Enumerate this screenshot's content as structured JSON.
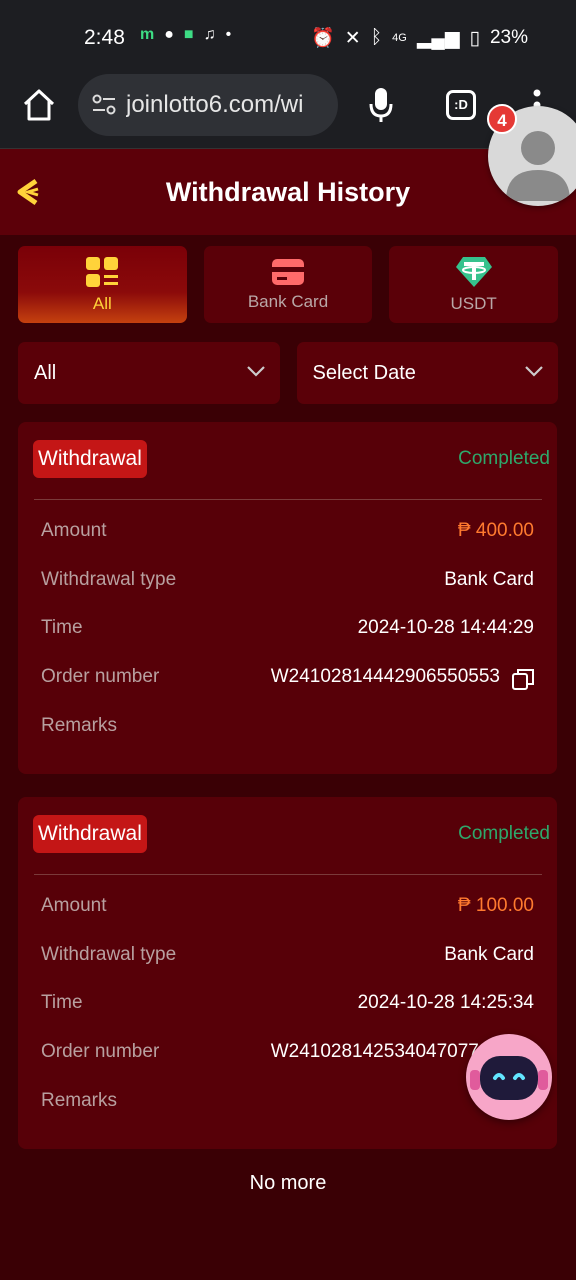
{
  "statusbar": {
    "time": "2:48",
    "network": "4G",
    "battery": "23%"
  },
  "browser": {
    "url": "joinlotto6.com/wi",
    "notification_count": "4",
    "tab_count": ":D"
  },
  "header": {
    "title": "Withdrawal History"
  },
  "tabs": [
    {
      "label": "All",
      "active": true,
      "icon": "grid-icon"
    },
    {
      "label": "Bank Card",
      "active": false,
      "icon": "bank-card-icon"
    },
    {
      "label": "USDT",
      "active": false,
      "icon": "usdt-icon"
    }
  ],
  "filters": {
    "type": "All",
    "date": "Select Date"
  },
  "labels": {
    "amount": "Amount",
    "type": "Withdrawal type",
    "time": "Time",
    "order": "Order number",
    "remarks": "Remarks"
  },
  "records": [
    {
      "kind": "Withdrawal",
      "status": "Completed",
      "amount": "₱ 400.00",
      "type": "Bank Card",
      "time": "2024-10-28 14:44:29",
      "order": "W2410281444290655055​3"
    },
    {
      "kind": "Withdrawal",
      "status": "Completed",
      "amount": "₱ 100.00",
      "type": "Bank Card",
      "time": "2024-10-28 14:25:34",
      "order": "W241028142534047077​91"
    }
  ],
  "footer": {
    "no_more": "No more"
  },
  "colors": {
    "accent": "#ffd33a",
    "status": "#2ea86b",
    "amount": "#ff7a2f",
    "badge": "#c41616"
  }
}
